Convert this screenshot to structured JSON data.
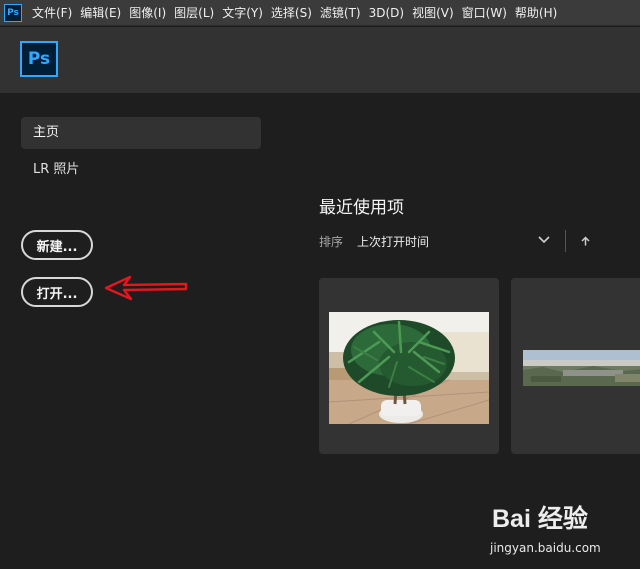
{
  "menubar": {
    "app_icon": "Ps",
    "items": [
      {
        "label": "文件(F)"
      },
      {
        "label": "编辑(E)"
      },
      {
        "label": "图像(I)"
      },
      {
        "label": "图层(L)"
      },
      {
        "label": "文字(Y)"
      },
      {
        "label": "选择(S)"
      },
      {
        "label": "滤镜(T)"
      },
      {
        "label": "3D(D)"
      },
      {
        "label": "视图(V)"
      },
      {
        "label": "窗口(W)"
      },
      {
        "label": "帮助(H)"
      }
    ]
  },
  "header": {
    "logo_text": "Ps",
    "brand_color": "#31a8ff"
  },
  "sidebar": {
    "items": [
      {
        "label": "主页",
        "selected": true
      },
      {
        "label": "LR 照片",
        "selected": false
      }
    ],
    "new_button": "新建...",
    "open_button": "打开..."
  },
  "annotation": {
    "arrow_color": "#e5161d",
    "icon": "left-arrow-icon"
  },
  "recent": {
    "title": "最近使用项",
    "sort_label": "排序",
    "sort_value": "上次打开时间",
    "sort_dropdown_icon": "chevron-down-icon",
    "sort_direction_icon": "arrow-up-icon",
    "files": [
      {
        "thumbnail": "potted-plant-photo"
      },
      {
        "thumbnail": "landscape-photo"
      }
    ]
  },
  "watermark": {
    "brand": "Bai 经验",
    "url": "jingyan.baidu.com"
  }
}
